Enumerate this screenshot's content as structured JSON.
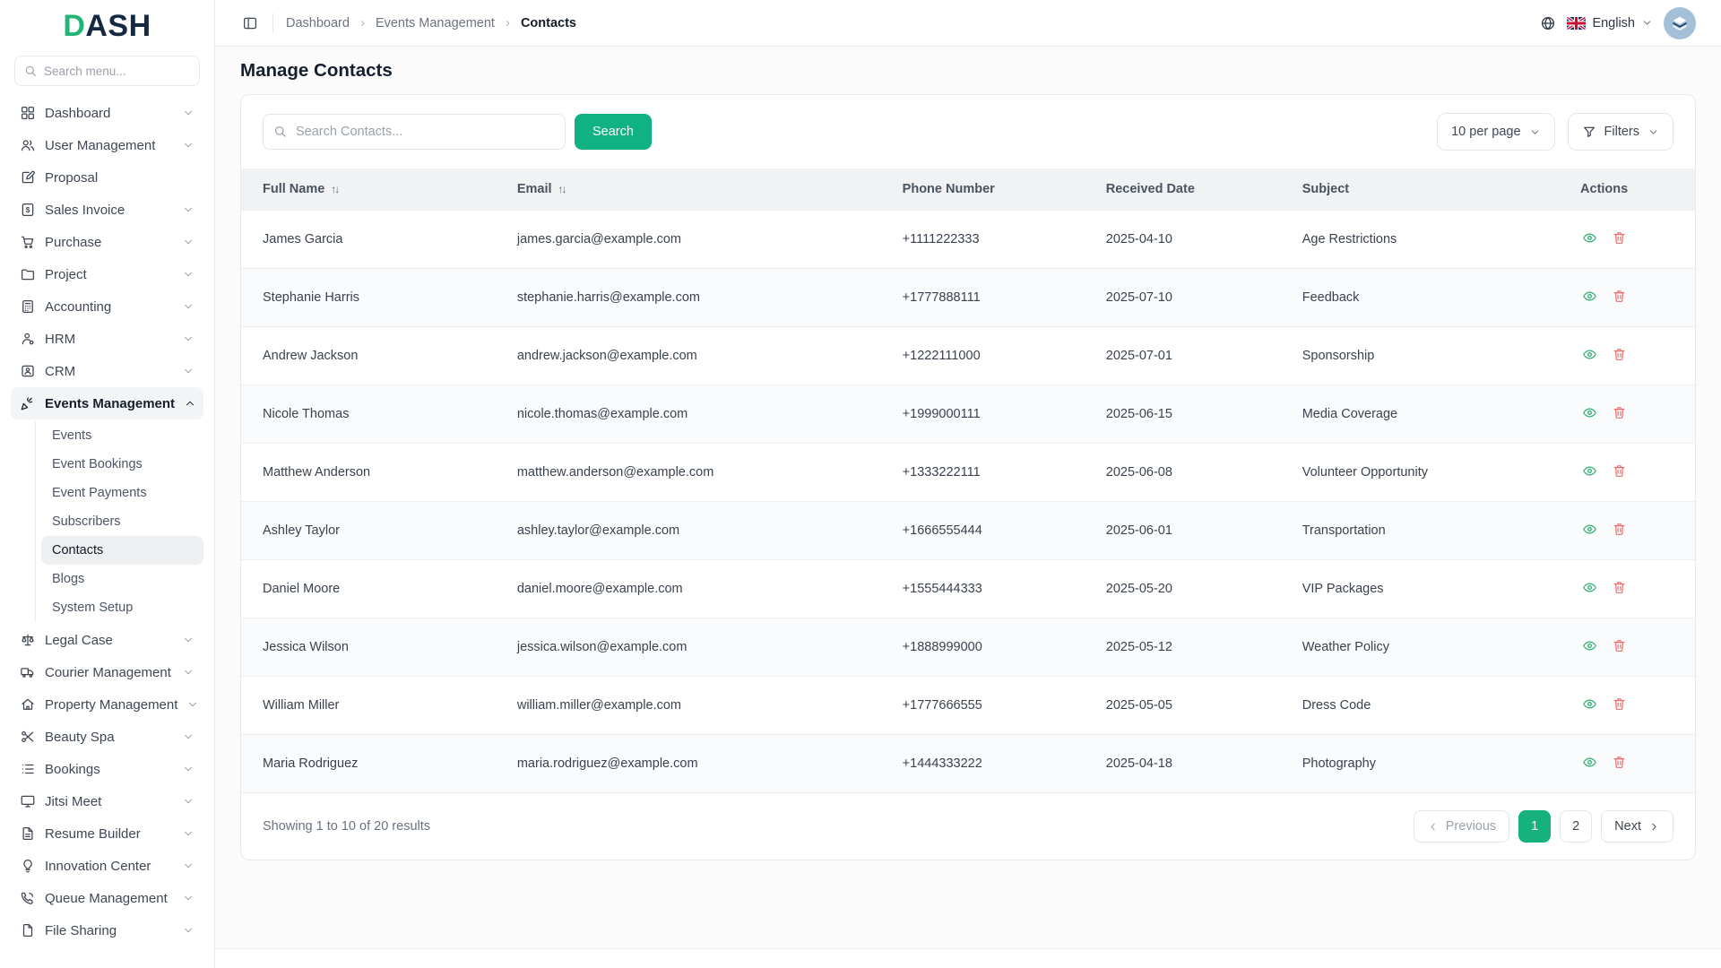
{
  "colors": {
    "accent_green": "#10b183",
    "logo_green": "#22b573",
    "logo_navy": "#152a42",
    "danger_red": "#ee6b6b",
    "header_bg": "#f0f2f3"
  },
  "brand": {
    "logo_first": "D",
    "logo_rest": "ASH"
  },
  "sidebar": {
    "search_placeholder": "Search menu...",
    "items": [
      {
        "label": "Dashboard",
        "icon": "grid-icon"
      },
      {
        "label": "User Management",
        "icon": "users-icon"
      },
      {
        "label": "Proposal",
        "icon": "proposal-icon"
      },
      {
        "label": "Sales Invoice",
        "icon": "invoice-icon"
      },
      {
        "label": "Purchase",
        "icon": "cart-icon"
      },
      {
        "label": "Project",
        "icon": "folder-icon"
      },
      {
        "label": "Accounting",
        "icon": "calculator-icon"
      },
      {
        "label": "HRM",
        "icon": "person-icon"
      },
      {
        "label": "CRM",
        "icon": "id-card-icon"
      },
      {
        "label": "Events Management",
        "icon": "party-popper-icon",
        "active": true,
        "expanded": true
      },
      {
        "label": "Legal Case",
        "icon": "scales-icon"
      },
      {
        "label": "Courier Management",
        "icon": "truck-icon"
      },
      {
        "label": "Property Management",
        "icon": "property-icon"
      },
      {
        "label": "Beauty Spa",
        "icon": "scissors-icon"
      },
      {
        "label": "Bookings",
        "icon": "list-icon"
      },
      {
        "label": "Jitsi Meet",
        "icon": "monitor-icon"
      },
      {
        "label": "Resume Builder",
        "icon": "resume-icon"
      },
      {
        "label": "Innovation Center",
        "icon": "lightbulb-icon"
      },
      {
        "label": "Queue Management",
        "icon": "phone-icon"
      },
      {
        "label": "File Sharing",
        "icon": "file-icon"
      }
    ],
    "events_submenu": [
      "Events",
      "Event Bookings",
      "Event Payments",
      "Subscribers",
      "Contacts",
      "Blogs",
      "System Setup"
    ],
    "active_submenu_item": "Contacts"
  },
  "topbar": {
    "breadcrumb": [
      "Dashboard",
      "Events Management",
      "Contacts"
    ],
    "separator": "›",
    "language": "English"
  },
  "page": {
    "title": "Manage Contacts"
  },
  "toolbar": {
    "search_placeholder": "Search Contacts...",
    "search_button": "Search",
    "per_page": "10 per page",
    "filters": "Filters"
  },
  "table": {
    "columns": [
      "Full Name",
      "Email",
      "Phone Number",
      "Received Date",
      "Subject",
      "Actions"
    ],
    "sort_glyph": "↑↓",
    "row_action_icons": {
      "view": "eye-icon",
      "delete": "trash-icon"
    },
    "rows": [
      {
        "full_name": "James Garcia",
        "email": "james.garcia@example.com",
        "phone": "+1111222333",
        "received_date": "2025-04-10",
        "subject": "Age Restrictions"
      },
      {
        "full_name": "Stephanie Harris",
        "email": "stephanie.harris@example.com",
        "phone": "+1777888111",
        "received_date": "2025-07-10",
        "subject": "Feedback"
      },
      {
        "full_name": "Andrew Jackson",
        "email": "andrew.jackson@example.com",
        "phone": "+1222111000",
        "received_date": "2025-07-01",
        "subject": "Sponsorship"
      },
      {
        "full_name": "Nicole Thomas",
        "email": "nicole.thomas@example.com",
        "phone": "+1999000111",
        "received_date": "2025-06-15",
        "subject": "Media Coverage"
      },
      {
        "full_name": "Matthew Anderson",
        "email": "matthew.anderson@example.com",
        "phone": "+1333222111",
        "received_date": "2025-06-08",
        "subject": "Volunteer Opportunity"
      },
      {
        "full_name": "Ashley Taylor",
        "email": "ashley.taylor@example.com",
        "phone": "+1666555444",
        "received_date": "2025-06-01",
        "subject": "Transportation"
      },
      {
        "full_name": "Daniel Moore",
        "email": "daniel.moore@example.com",
        "phone": "+1555444333",
        "received_date": "2025-05-20",
        "subject": "VIP Packages"
      },
      {
        "full_name": "Jessica Wilson",
        "email": "jessica.wilson@example.com",
        "phone": "+1888999000",
        "received_date": "2025-05-12",
        "subject": "Weather Policy"
      },
      {
        "full_name": "William Miller",
        "email": "william.miller@example.com",
        "phone": "+1777666555",
        "received_date": "2025-05-05",
        "subject": "Dress Code"
      },
      {
        "full_name": "Maria Rodriguez",
        "email": "maria.rodriguez@example.com",
        "phone": "+1444333222",
        "received_date": "2025-04-18",
        "subject": "Photography"
      }
    ]
  },
  "footer": {
    "showing": "Showing 1 to 10 of 20 results",
    "previous": "Previous",
    "next": "Next",
    "pages": [
      "1",
      "2"
    ],
    "active_page": "1"
  }
}
